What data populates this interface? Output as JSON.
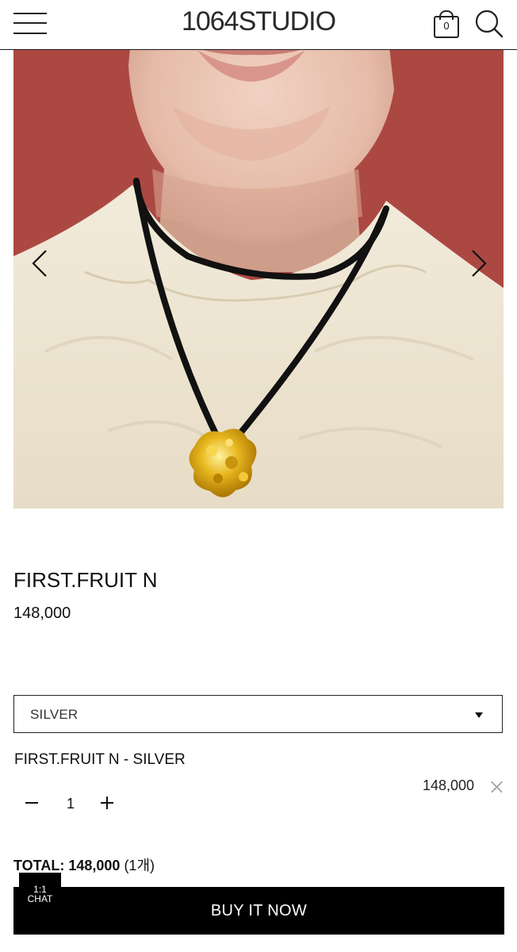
{
  "header": {
    "brand": "1064STUDIO",
    "cart_count": "0"
  },
  "icons": {
    "menu": "hamburger-menu-icon",
    "cart": "shopping-bag-icon",
    "search": "search-icon",
    "prev": "chevron-left-icon",
    "next": "chevron-right-icon",
    "remove": "close-icon"
  },
  "product": {
    "name": "FIRST.FRUIT N",
    "price": "148,000"
  },
  "option": {
    "selected": "SILVER"
  },
  "selected_item": {
    "name": "FIRST.FRUIT N - SILVER",
    "price": "148,000",
    "quantity": "1"
  },
  "total": {
    "label": "TOTAL:",
    "amount": "148,000",
    "count": "(1개)"
  },
  "buy_button": "BUY IT NOW",
  "chat": {
    "line1": "1:1",
    "line2": "CHAT"
  }
}
